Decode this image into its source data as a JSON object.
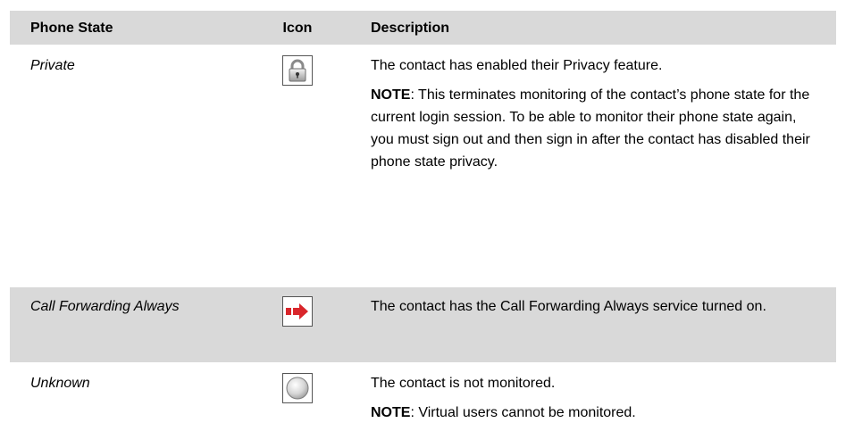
{
  "table": {
    "headers": [
      "Phone State",
      "Icon",
      "Description"
    ],
    "rows": [
      {
        "state": "Private",
        "icon": "lock-icon",
        "description": "The contact has enabled their Privacy feature.",
        "note_label": "NOTE",
        "note_text": ":  This terminates monitoring of the contact’s phone state for the current login session.  To be able to monitor their phone state again, you must sign out and then sign in after the contact has disabled their phone state privacy."
      },
      {
        "state": "Call Forwarding Always",
        "icon": "red-arrow-icon",
        "description": "The contact has the Call Forwarding Always service turned on."
      },
      {
        "state": "Unknown",
        "icon": "gray-circle-icon",
        "description": "The contact is not monitored.",
        "note_label": "NOTE",
        "note_text": ":  Virtual users cannot be monitored."
      }
    ]
  },
  "colors": {
    "header_bg": "#d9d9d9",
    "shaded_row_bg": "#d9d9d9",
    "arrow_red": "#d9262b"
  }
}
